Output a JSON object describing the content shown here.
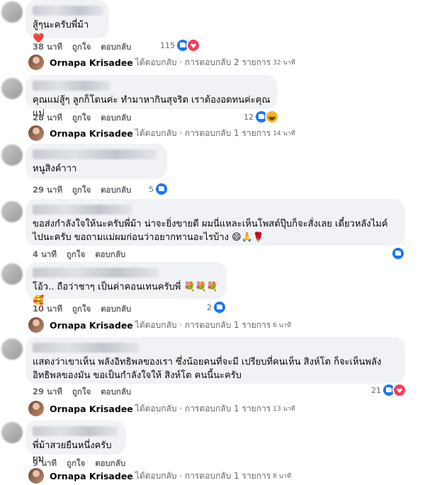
{
  "comments": [
    {
      "text": "สู้ๆนะครับพี่ม้า ❤️",
      "time": "38 นาที",
      "like": "ถูกใจ",
      "reply": "ตอบกลับ",
      "reactions": "115"
    },
    {
      "text": "คุณแม่สู้ๆ ลูกก็โดนค่ะ ทำมาหากินสุจริต เราต้องอดทนค่ะคุณแม่",
      "time": "28 นาที",
      "like": "ถูกใจ",
      "reply": "ตอบกลับ",
      "reactions": "12"
    },
    {
      "text": "หนูสิงค์าาา",
      "time": "29 นาที",
      "like": "ถูกใจ",
      "reply": "ตอบกลับ",
      "reactions": "5"
    },
    {
      "text": "ขอส่งกำลังใจให้นะครับพี่ม้า น่าจะยิ่งขายดี ผมนี่แหละเห็นโพสต์ปุ๊บก็จะสั่งเลย เดี๋ยวหลังไมค์ไปนะครับ ขอถามแม่ผมก่อนว่าอยากทานอะไรบ้าง 😄🙏🌹",
      "time": "4 นาที",
      "like": "ถูกใจ",
      "reply": "ตอบกลับ",
      "reactions": ""
    },
    {
      "text": "โอ้ว.. ถือว่าชาๆ เป็นค่าคอนเทนครับพี่ 💐💐💐🥰",
      "time": "10 นาที",
      "like": "ถูกใจ",
      "reply": "ตอบกลับ",
      "reactions": "2"
    },
    {
      "text": "แสดงว่าเขาเห็น พลังอิทธิพลของเรา ซึ่งน้อยคนที่จะมี เปรียบที่คนเห็น สิงห์โต ก็จะเห็นพลังอิทธิพลของมัน ขอเป็นกำลังใจให้ สิงห์โต คนนี้นะครับ",
      "time": "29 นาที",
      "like": "ถูกใจ",
      "reply": "ตอบกลับ",
      "reactions": "21"
    },
    {
      "text": "พี่ม้าสวยยืนหนึ่งครับผม",
      "time": "9 นาที",
      "like": "ถูกใจ",
      "reply": "ตอบกลับ",
      "reactions": ""
    }
  ],
  "replies": [
    {
      "name": "Ornapa Krisadee",
      "action": "ได้ตอบกลับ",
      "count": "· การตอบกลับ 2 รายการ",
      "when": "32 นาที"
    },
    {
      "name": "Ornapa Krisadee",
      "action": "ได้ตอบกลับ",
      "count": "· การตอบกลับ 1 รายการ",
      "when": "14 นาที"
    },
    {
      "name": "Ornapa Krisadee",
      "action": "ได้ตอบกลับ",
      "count": "· การตอบกลับ 1 รายการ",
      "when": "6 นาที"
    },
    {
      "name": "Ornapa Krisadee",
      "action": "ได้ตอบกลับ",
      "count": "· การตอบกลับ 1 รายการ",
      "when": "13 นาที"
    },
    {
      "name": "Ornapa Krisadee",
      "action": "ได้ตอบกลับ",
      "count": "· การตอบกลับ 1 รายการ",
      "when": "8 นาที"
    }
  ]
}
